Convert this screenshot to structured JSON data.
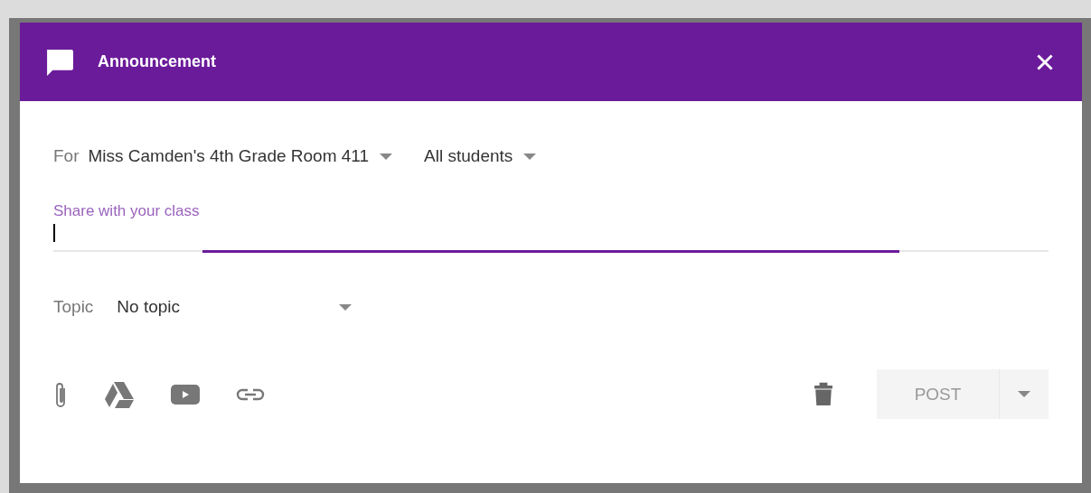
{
  "dialog": {
    "title": "Announcement"
  },
  "recipients": {
    "label": "For",
    "class_name": "Miss Camden's 4th Grade Room 411",
    "audience": "All students"
  },
  "message_field": {
    "placeholder": "Share with your class",
    "focused": true
  },
  "topic": {
    "label": "Topic",
    "value": "No topic"
  },
  "attachments": [
    {
      "kind": "file"
    },
    {
      "kind": "drive"
    },
    {
      "kind": "video"
    },
    {
      "kind": "link"
    }
  ],
  "post_button": {
    "label": "POST",
    "disabled": true
  }
}
